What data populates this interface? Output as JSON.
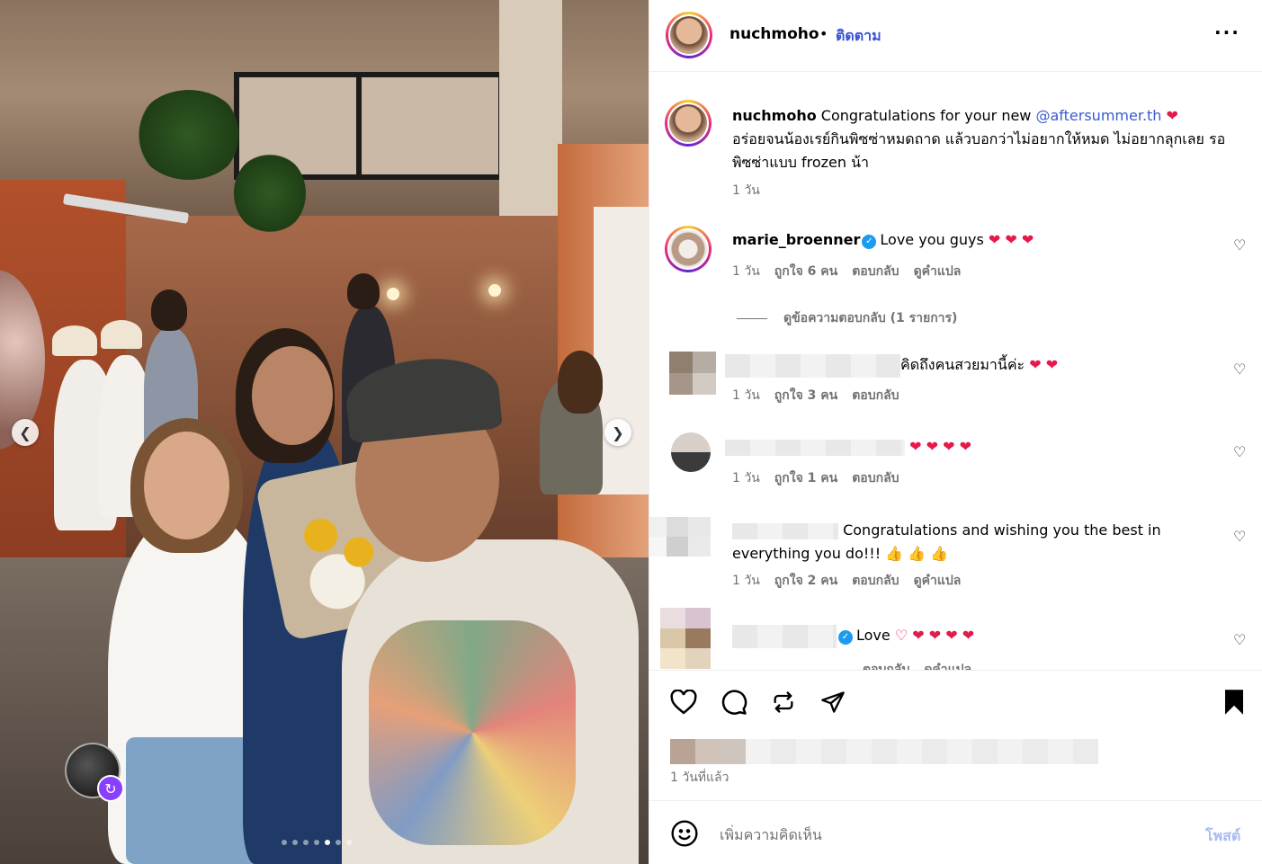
{
  "post": {
    "author": "nuchmoho",
    "follow_label": "ติดตาม",
    "bullet": "•",
    "more_icon": "more-horizontal-icon",
    "carousel": {
      "slides": 7,
      "active_index": 4
    }
  },
  "caption": {
    "username": "nuchmoho",
    "text_1": "Congratulations for your new ",
    "mention": "@aftersummer.th",
    "heart": "❤",
    "text_2": "อร่อยจนน้องเรย์กินพิซซ่าหมดถาด แล้วบอกว่าไม่อยากให้หมด ไม่อยากลุกเลย รอพิซซ่าแบบ frozen น้า",
    "time": "1 วัน"
  },
  "comments": [
    {
      "username": "marie_broenner",
      "verified": true,
      "text": "Love you guys",
      "emoji": "❤ ❤ ❤",
      "time": "1 วัน",
      "likes": "ถูกใจ 6 คน",
      "reply": "ตอบกลับ",
      "translate": "ดูคำแปล"
    },
    {
      "text": "คิดถึงคนสวยมานี้ค่ะ",
      "emoji": "❤ ❤",
      "time": "1 วัน",
      "likes": "ถูกใจ 3 คน",
      "reply": "ตอบกลับ"
    },
    {
      "emoji": "❤ ❤ ❤ ❤",
      "time": "1 วัน",
      "likes": "ถูกใจ 1 คน",
      "reply": "ตอบกลับ"
    },
    {
      "text_1": "Congratulations and wishing you the best in",
      "text_2": "everything you do!!!",
      "emoji": "👍 👍 👍",
      "time": "1 วัน",
      "likes": "ถูกใจ 2 คน",
      "reply": "ตอบกลับ",
      "translate": "ดูคำแปล"
    },
    {
      "verified": true,
      "text": "Love",
      "emoji": "♡ ❤ ❤ ❤ ❤",
      "reply": "ตอบกลับ",
      "translate": "ดูคำแปล"
    }
  ],
  "view_replies": "ดูข้อความตอบกลับ (1 รายการ)",
  "actions": {
    "like_icon": "heart-outline-icon",
    "comment_icon": "comment-bubble-icon",
    "share_icon": "repost-icon",
    "send_icon": "paper-plane-icon",
    "save_icon": "bookmark-filled-icon",
    "post_time": "1 วันที่แล้ว"
  },
  "add_comment": {
    "placeholder": "เพิ่มความคิดเห็น",
    "post_label": "โพสต์"
  },
  "colors": {
    "accent_blue": "#3950d6",
    "heart_red": "#e5194a",
    "muted": "#737373",
    "post_disabled": "#a9bbf0"
  }
}
